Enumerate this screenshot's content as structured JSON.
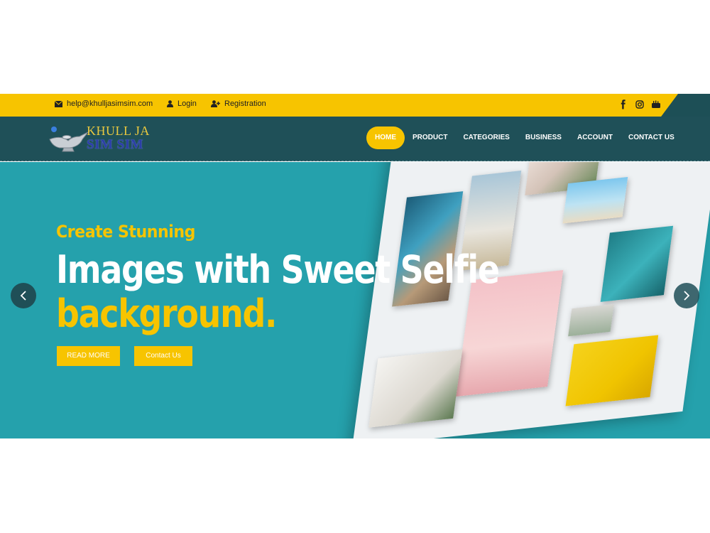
{
  "topbar": {
    "email": "help@khulljasimsim.com",
    "login": "Login",
    "registration": "Registration",
    "social_icons": [
      "facebook-icon",
      "instagram-icon",
      "youtube-icon"
    ]
  },
  "logo": {
    "line1": "KHULL JA",
    "line2": "SIM SIM"
  },
  "nav": {
    "items": [
      "HOME",
      "PRODUCT",
      "CATEGORIES",
      "BUSINESS",
      "ACCOUNT",
      "CONTACT US"
    ],
    "active": "HOME"
  },
  "hero": {
    "subtitle": "Create Stunning",
    "title_line1": "Images with Sweet Selfie",
    "title_line2": "background.",
    "read_more": "READ MORE",
    "contact_us": "Contact Us"
  },
  "colors": {
    "accent": "#f7c400",
    "hero_bg": "#25a1ac",
    "nav_bg": "#1f5058"
  }
}
